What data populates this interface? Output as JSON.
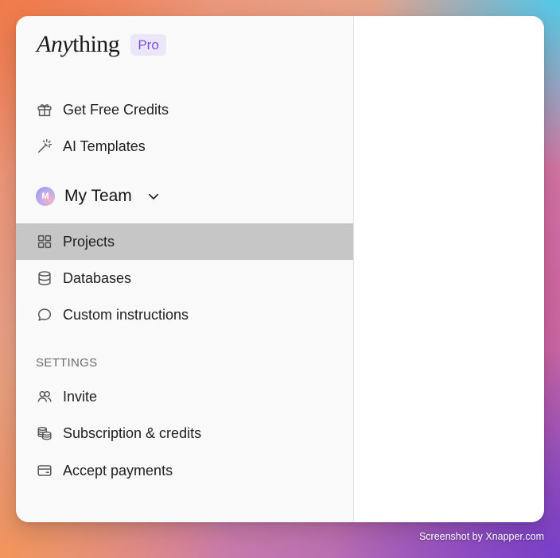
{
  "brand": {
    "logo_prefix": "Any",
    "logo_suffix": "thing",
    "badge": "Pro"
  },
  "top_links": [
    {
      "label": "Get Free Credits",
      "icon": "gift-icon"
    },
    {
      "label": "AI Templates",
      "icon": "magic-wand-icon"
    }
  ],
  "team": {
    "avatar_initial": "M",
    "name": "My Team",
    "icon": "chevron-down-icon"
  },
  "nav": [
    {
      "label": "Projects",
      "icon": "grid-icon",
      "active": true
    },
    {
      "label": "Databases",
      "icon": "database-icon",
      "active": false
    },
    {
      "label": "Custom instructions",
      "icon": "chat-bubble-icon",
      "active": false
    }
  ],
  "settings": {
    "heading": "SETTINGS",
    "items": [
      {
        "label": "Invite",
        "icon": "users-icon"
      },
      {
        "label": "Subscription & credits",
        "icon": "coins-icon"
      },
      {
        "label": "Accept payments",
        "icon": "credit-card-icon"
      }
    ]
  },
  "colors": {
    "badge_bg": "#ece6fb",
    "badge_text": "#7a4de0",
    "active_item_bg": "#c6c6c6",
    "sidebar_bg": "#f9f9f9"
  },
  "footer": {
    "credit": "Screenshot by Xnapper.com"
  }
}
